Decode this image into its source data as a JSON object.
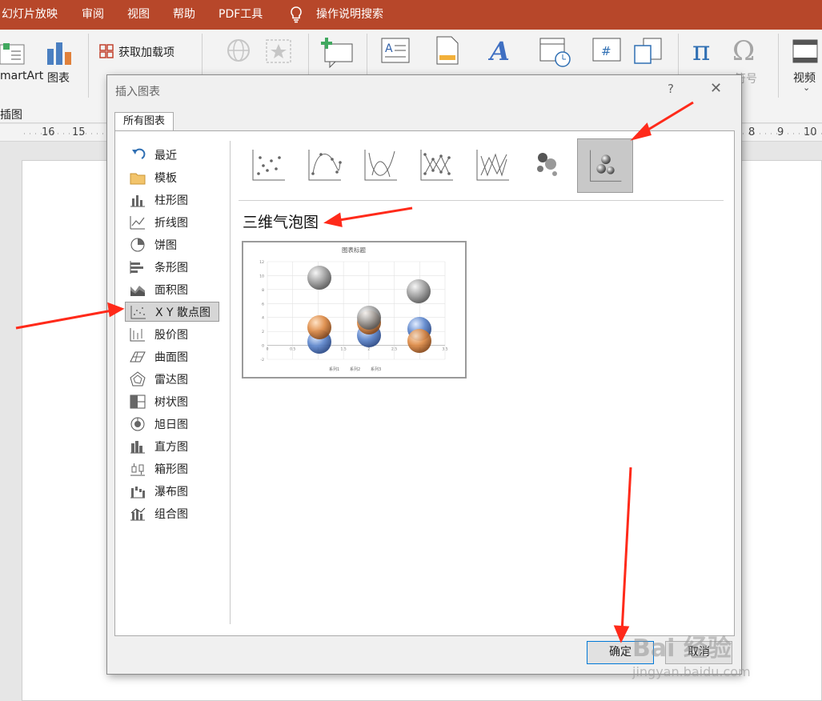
{
  "menu": {
    "tabs": [
      "幻灯片放映",
      "审阅",
      "视图",
      "帮助",
      "PDF工具"
    ],
    "search": "操作说明搜索"
  },
  "ribbon": {
    "smartart": "martArt",
    "chart": "图表",
    "group_illustrations": "插图",
    "addins": "获取加载项",
    "video": "视频",
    "symbol": "符号"
  },
  "ruler": [
    "16",
    "15",
    "8",
    "9",
    "10"
  ],
  "dialog": {
    "title": "插入图表",
    "help": "?",
    "close": "✕",
    "tab": "所有图表",
    "categories": [
      "最近",
      "模板",
      "柱形图",
      "折线图",
      "饼图",
      "条形图",
      "面积图",
      "X Y 散点图",
      "股价图",
      "曲面图",
      "雷达图",
      "树状图",
      "旭日图",
      "直方图",
      "箱形图",
      "瀑布图",
      "组合图"
    ],
    "selected_category": "X Y 散点图",
    "chart_type_name": "三维气泡图",
    "ok": "确定",
    "cancel": "取消"
  },
  "preview": {
    "title": "图表标题",
    "legend": [
      "系列1",
      "系列2",
      "系列3"
    ],
    "y_ticks": [
      "12",
      "10",
      "8",
      "6",
      "4",
      "2",
      "0",
      "-2"
    ],
    "x_ticks": [
      "0",
      "0.5",
      "1",
      "1.5",
      "2",
      "2.5",
      "3",
      "3.5"
    ]
  },
  "watermark": {
    "brand": "Bai 经验",
    "url": "jingyan.baidu.com"
  },
  "colors": {
    "ribbon_red": "#b7472a",
    "bubble_gray": "#9a9a9a",
    "bubble_orange": "#d9823a",
    "bubble_blue": "#5b82c8",
    "arrow_red": "#ff2a1a"
  }
}
